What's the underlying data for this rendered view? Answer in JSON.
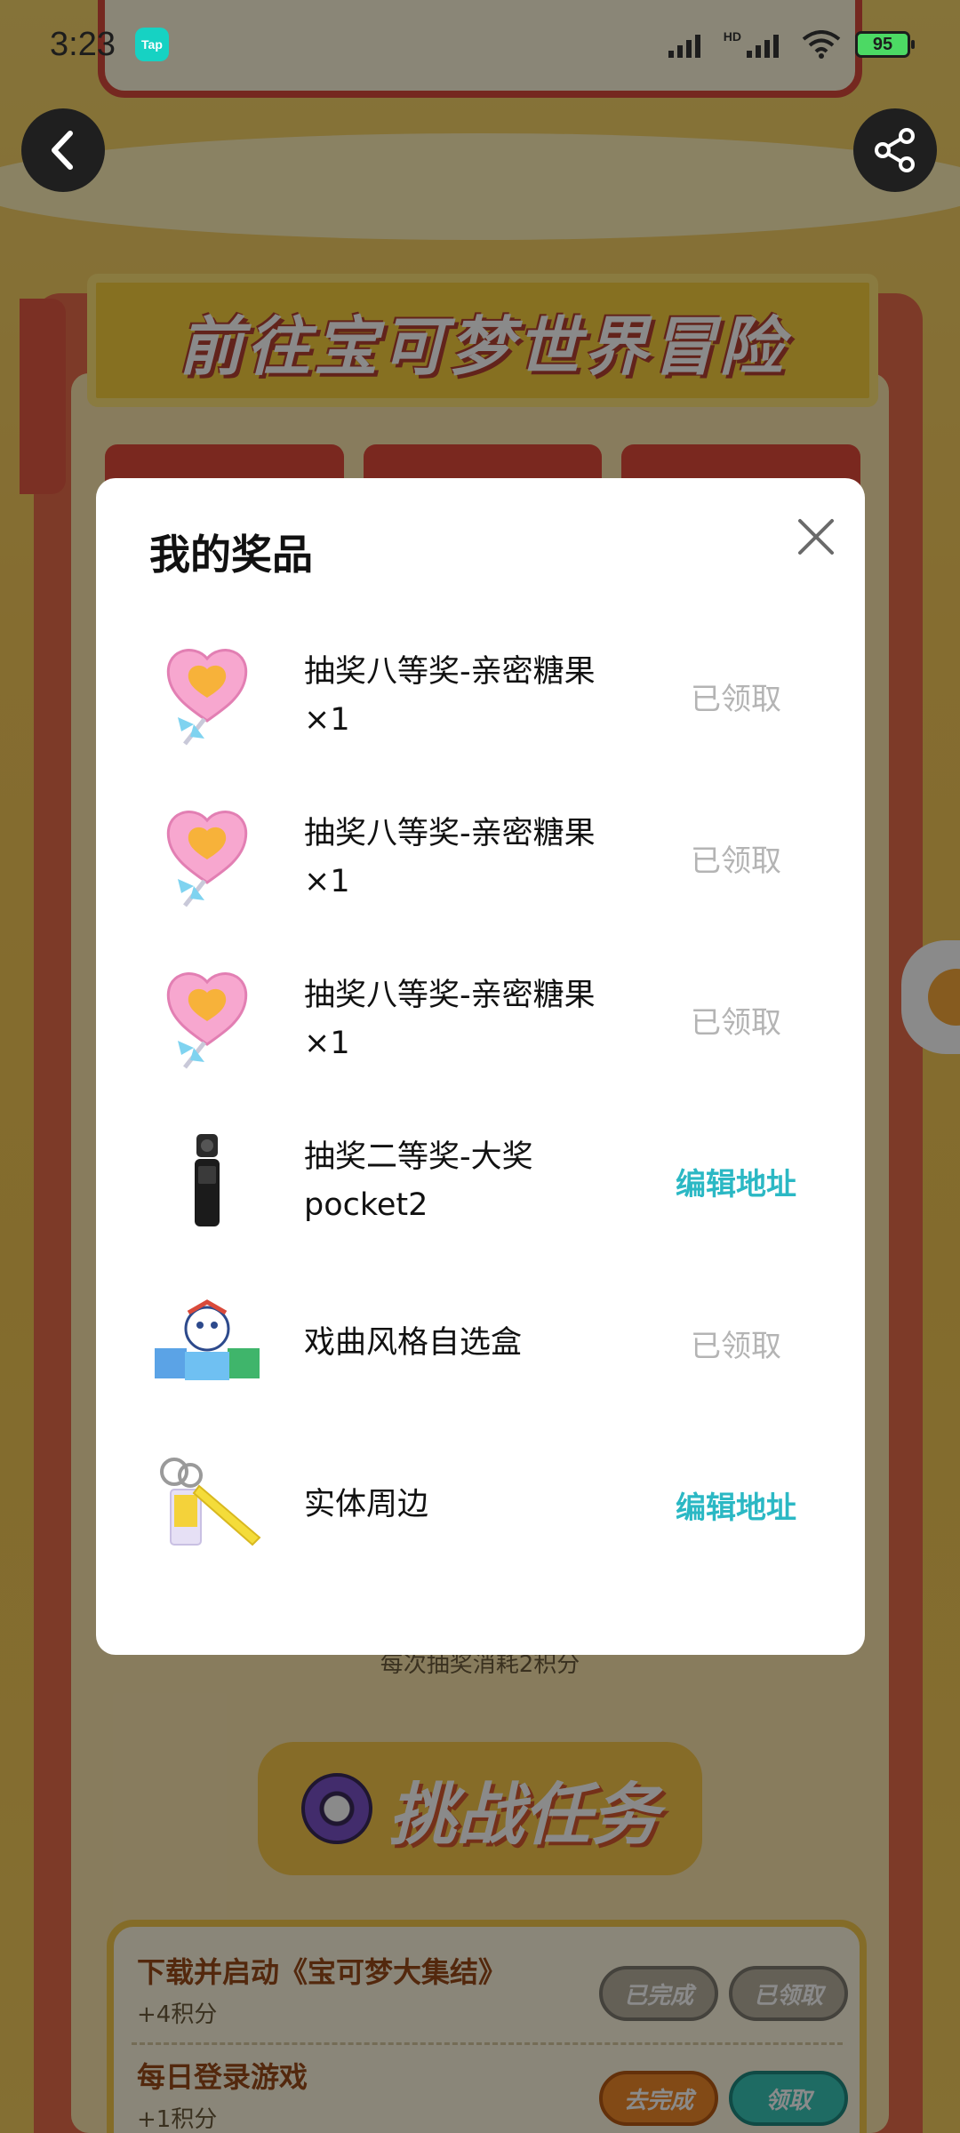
{
  "status_bar": {
    "time": "3:23",
    "app_badge": "Tap",
    "network_label": "HD",
    "battery_level": "95"
  },
  "background": {
    "banner_title": "前往宝可梦世界冒险",
    "draw_note": "每次抽奖消耗2积分",
    "challenge_title": "挑战任务",
    "tasks": [
      {
        "title": "下载并启动《宝可梦大集结》",
        "reward": "+4积分",
        "buttons": [
          "已完成",
          "已领取"
        ]
      },
      {
        "title": "每日登录游戏",
        "reward": "+1积分",
        "buttons": [
          "去完成",
          "领取"
        ]
      }
    ]
  },
  "modal": {
    "title": "我的奖品",
    "prizes": [
      {
        "name": "抽奖八等奖-亲密糖果×1",
        "action": "已领取",
        "status": "claimed",
        "icon": "candy-icon"
      },
      {
        "name": "抽奖八等奖-亲密糖果×1",
        "action": "已领取",
        "status": "claimed",
        "icon": "candy-icon"
      },
      {
        "name": "抽奖八等奖-亲密糖果×1",
        "action": "已领取",
        "status": "claimed",
        "icon": "candy-icon"
      },
      {
        "name": "抽奖二等奖-大奖pocket2",
        "action": "编辑地址",
        "status": "edit",
        "icon": "camera-icon"
      },
      {
        "name": "戏曲风格自选盒",
        "action": "已领取",
        "status": "claimed",
        "icon": "gift-box-icon"
      },
      {
        "name": "实体周边",
        "action": "编辑地址",
        "status": "edit",
        "icon": "keychain-icon"
      }
    ]
  },
  "colors": {
    "accent": "#2bb8c4",
    "claimed_text": "#b4b4b4",
    "background_yellow": "#f3c653"
  }
}
